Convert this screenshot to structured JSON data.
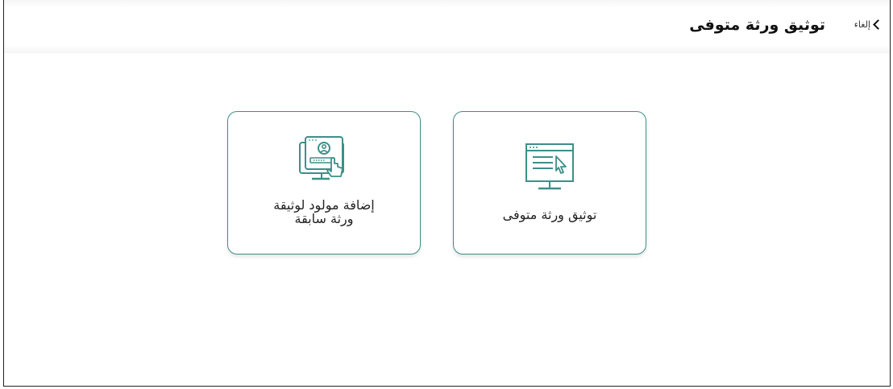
{
  "header": {
    "title": "توثيق ورثة متوفى",
    "cancel_label": "إلغاء"
  },
  "options": [
    {
      "label": "توثيق ورثة متوفى",
      "icon": "monitor-cursor-icon"
    },
    {
      "label_line1": "إضافة مولود لوثيقة",
      "label_line2": "ورثة سابقة",
      "icon": "monitor-user-touch-icon"
    }
  ],
  "colors": {
    "accent": "#3d8f88",
    "border": "#222222"
  }
}
